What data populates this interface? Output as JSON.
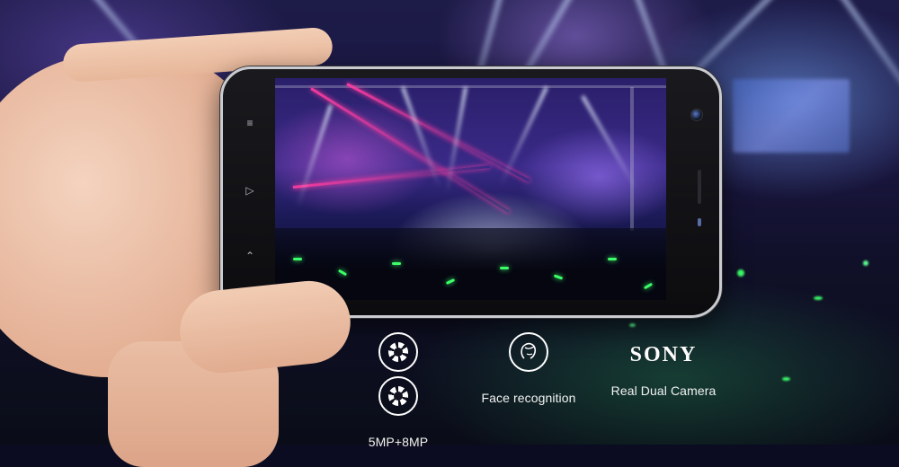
{
  "features": [
    {
      "id": "camera",
      "icons": [
        "camera-aperture-icon",
        "camera-aperture-icon"
      ],
      "caption": "5MP+8MP"
    },
    {
      "id": "face",
      "icons": [
        "face-recognition-icon"
      ],
      "caption": "Face recognition"
    },
    {
      "id": "sony",
      "logo_text": "SONY",
      "caption": "Real Dual Camera"
    }
  ],
  "phone_nav_icons": [
    "menu-icon",
    "home-icon",
    "back-icon"
  ],
  "colors": {
    "background": "#0b0b22",
    "text": "#f2f2f2",
    "laser": "#ff3ca0",
    "glowstick": "#3cff6a",
    "phone_frame": "#c9cbd0"
  }
}
